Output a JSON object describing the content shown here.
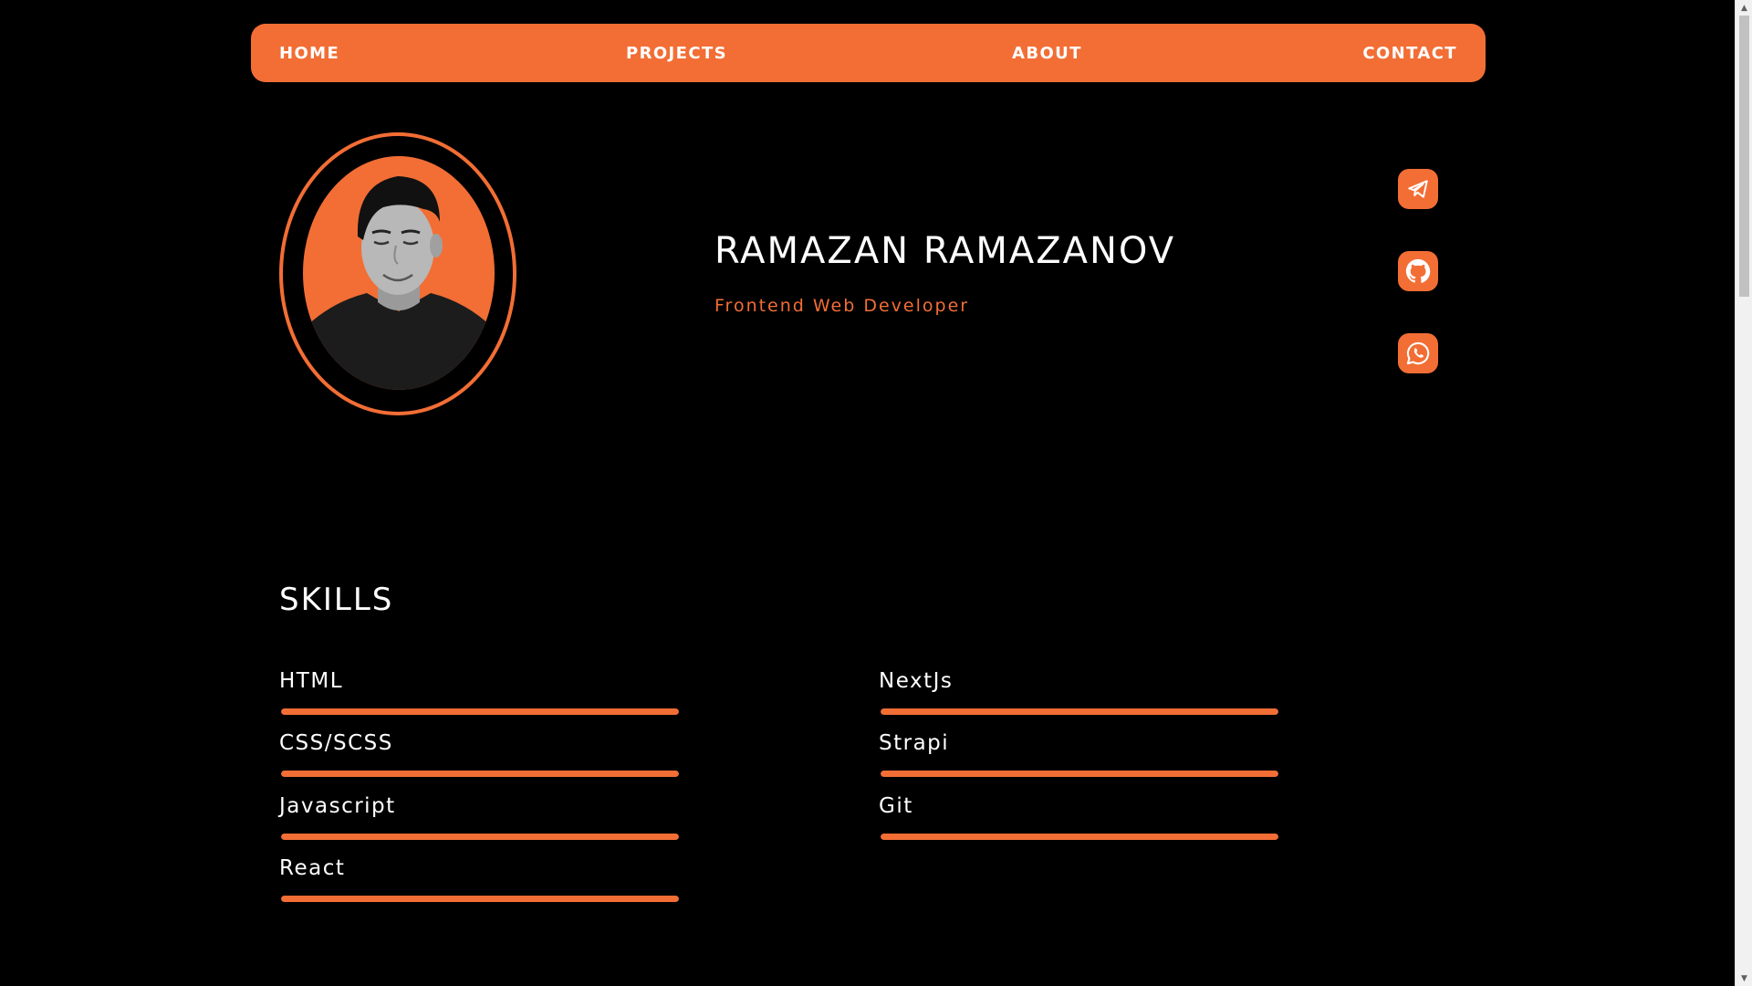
{
  "nav": {
    "home": "HOME",
    "projects": "PROJECTS",
    "about": "ABOUT",
    "contact": "CONTACT"
  },
  "hero": {
    "name": "RAMAZAN RAMAZANOV",
    "role": "Frontend Web Developer",
    "avatar_icon": "person-photo"
  },
  "social": {
    "items": [
      {
        "icon": "telegram-icon"
      },
      {
        "icon": "github-icon"
      },
      {
        "icon": "whatsapp-icon"
      }
    ]
  },
  "skills": {
    "title": "SKILLS",
    "items": [
      {
        "label": "HTML",
        "level": 1.0
      },
      {
        "label": "CSS/SCSS",
        "level": 1.0
      },
      {
        "label": "Javascript",
        "level": 1.0
      },
      {
        "label": "React",
        "level": 1.0
      },
      {
        "label": "NextJs",
        "level": 1.0
      },
      {
        "label": "Strapi",
        "level": 1.0
      },
      {
        "label": "Git",
        "level": 1.0
      }
    ]
  },
  "colors": {
    "accent": "#f26e35",
    "background": "#000000",
    "text": "#ffffff"
  }
}
